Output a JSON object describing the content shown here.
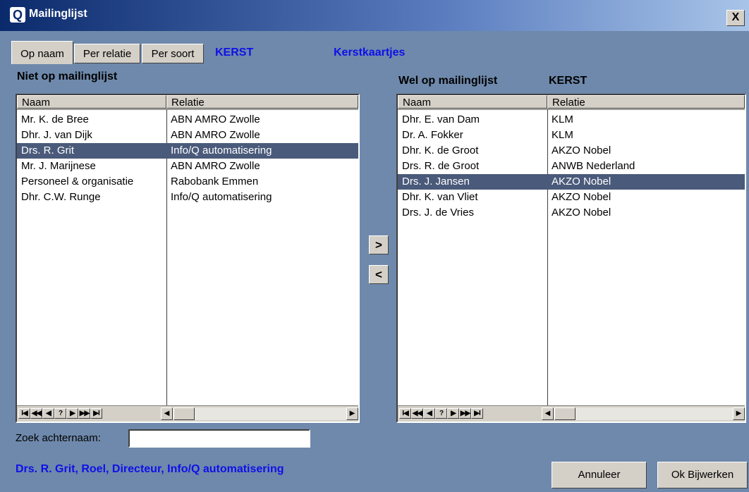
{
  "window": {
    "title": "Mailinglijst",
    "logo": "Q",
    "close_label": "X"
  },
  "tabs": [
    "Op naam",
    "Per relatie",
    "Per soort"
  ],
  "header": {
    "code": "KERST",
    "description": "Kerstkaartjes"
  },
  "left": {
    "label": "Niet op mailinglijst",
    "columns": [
      "Naam",
      "Relatie"
    ],
    "rows": [
      {
        "naam": "Mr. K. de Bree",
        "relatie": "ABN AMRO Zwolle"
      },
      {
        "naam": "Dhr. J. van Dijk",
        "relatie": "ABN AMRO Zwolle"
      },
      {
        "naam": "Drs. R. Grit",
        "relatie": "Info/Q automatisering"
      },
      {
        "naam": "Mr. J. Marijnese",
        "relatie": "ABN AMRO Zwolle"
      },
      {
        "naam": "Personeel & organisatie",
        "relatie": "Rabobank Emmen"
      },
      {
        "naam": "Dhr. C.W. Runge",
        "relatie": "Info/Q automatisering"
      }
    ],
    "selected_index": 2
  },
  "right": {
    "label": "Wel op mailinglijst",
    "code": "KERST",
    "columns": [
      "Naam",
      "Relatie"
    ],
    "rows": [
      {
        "naam": "Dhr. E. van Dam",
        "relatie": "KLM"
      },
      {
        "naam": "Dr. A. Fokker",
        "relatie": "KLM"
      },
      {
        "naam": "Dhr. K. de Groot",
        "relatie": "AKZO Nobel"
      },
      {
        "naam": "Drs. R. de Groot",
        "relatie": "ANWB Nederland"
      },
      {
        "naam": "Drs. J. Jansen",
        "relatie": "AKZO Nobel"
      },
      {
        "naam": "Dhr. K. van Vliet",
        "relatie": "AKZO Nobel"
      },
      {
        "naam": "Drs. J. de Vries",
        "relatie": "AKZO Nobel"
      }
    ],
    "selected_index": 4
  },
  "navigator": [
    "I◀",
    "◀◀",
    "◀",
    "?",
    "▶",
    "▶▶",
    "▶I"
  ],
  "scroll": {
    "left_arrow": "◀",
    "right_arrow": "▶"
  },
  "move": {
    "add_label": ">",
    "remove_label": "<"
  },
  "search": {
    "label": "Zoek achternaam:",
    "value": ""
  },
  "status_text": "Drs. R. Grit,  Roel,  Directeur, Info/Q automatisering",
  "buttons": {
    "cancel": "Annuleer",
    "ok": "Ok Bijwerken"
  }
}
